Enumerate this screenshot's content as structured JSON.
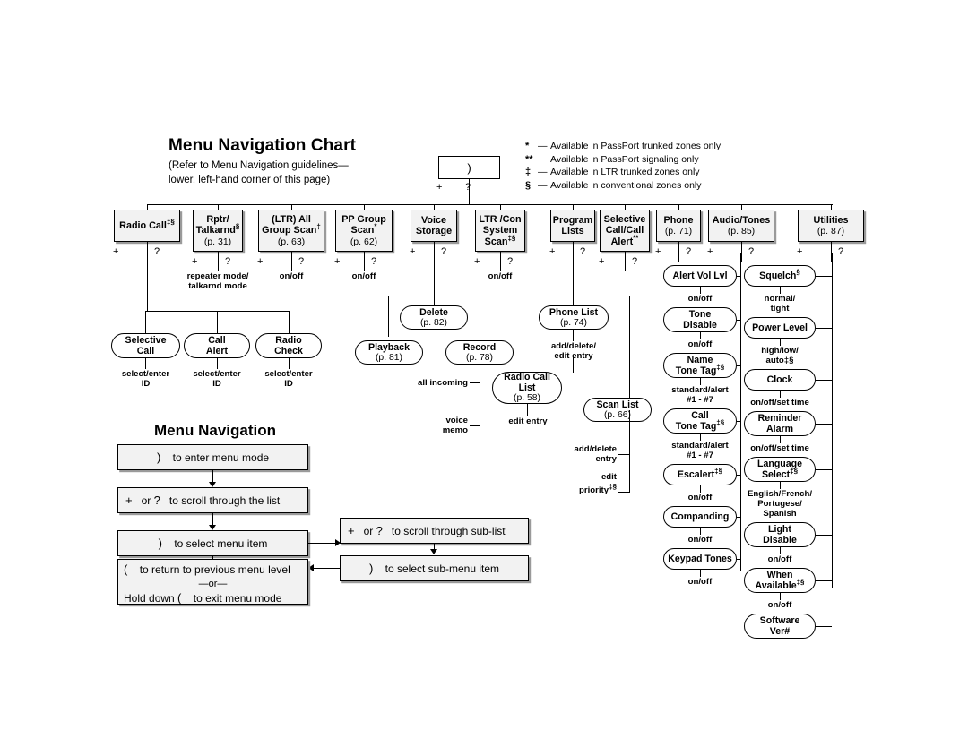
{
  "header": {
    "title": "Menu Navigation Chart",
    "subtitle_line1": "(Refer to Menu Navigation guidelines—",
    "subtitle_line2": "lower, left-hand corner of this page)",
    "enter_box_symbol": ")",
    "enter_box_plus": "+",
    "enter_box_minus": "?"
  },
  "legend": [
    {
      "symbol": "*",
      "dash": "—",
      "text": "Available in PassPort trunked zones only"
    },
    {
      "symbol": "**",
      "dash": "",
      "text": "Available in PassPort signaling only"
    },
    {
      "symbol": "‡",
      "dash": "—",
      "text": "Available in LTR trunked zones only"
    },
    {
      "symbol": "§",
      "dash": "—",
      "text": "Available in conventional zones only"
    }
  ],
  "top_menus": [
    {
      "name": "Radio Call",
      "sup": "‡§",
      "page": "",
      "plus": "+",
      "minus": "?",
      "note": ""
    },
    {
      "name": "Rptr/\nTalkarnd",
      "sup": "§",
      "page": "(p. 31)",
      "plus": "+",
      "minus": "?",
      "note": "repeater mode/\ntalkarnd mode"
    },
    {
      "name": "(LTR) All\nGroup Scan",
      "sup": "‡",
      "page": "(p. 63)",
      "plus": "+",
      "minus": "?",
      "note": "on/off"
    },
    {
      "name": "PP Group\nScan",
      "sup": "*",
      "page": "(p. 62)",
      "plus": "+",
      "minus": "?",
      "note": "on/off"
    },
    {
      "name": "Voice\nStorage",
      "sup": "",
      "page": "",
      "plus": "+",
      "minus": "?",
      "note": ""
    },
    {
      "name": "LTR /Con\nSystem\nScan",
      "sup": "‡§",
      "page": "",
      "plus": "+",
      "minus": "?",
      "note": "on/off"
    },
    {
      "name": "Program\nLists",
      "sup": "",
      "page": "",
      "plus": "+",
      "minus": "?",
      "note": ""
    },
    {
      "name": "Selective\nCall/Call\nAlert",
      "sup": "**",
      "page": "",
      "plus": "+",
      "minus": "?",
      "note": ""
    },
    {
      "name": "Phone",
      "sup": "",
      "page": "(p. 71)",
      "plus": "+",
      "minus": "?",
      "note": ""
    },
    {
      "name": "Audio/Tones",
      "sup": "",
      "page": "(p. 85)",
      "plus": "+",
      "minus": "?",
      "note": ""
    },
    {
      "name": "Utilities",
      "sup": "",
      "page": "(p. 87)",
      "plus": "+",
      "minus": "?",
      "note": ""
    }
  ],
  "radio_call_children": [
    {
      "name": "Selective\nCall",
      "note": "select/enter\nID"
    },
    {
      "name": "Call\nAlert",
      "note": "select/enter\nID"
    },
    {
      "name": "Radio\nCheck",
      "note": "select/enter\nID"
    }
  ],
  "voice_storage": {
    "delete": {
      "name": "Delete",
      "page": "(p. 82)"
    },
    "playback": {
      "name": "Playback",
      "page": "(p. 81)"
    },
    "record": {
      "name": "Record",
      "page": "(p. 78)"
    },
    "record_opt1": "all incoming",
    "record_opt2": "voice\nmemo"
  },
  "program_lists": {
    "phone_list": {
      "name": "Phone List",
      "page": "(p. 74)"
    },
    "phone_note": "add/delete/\nedit entry",
    "radio_call_list": {
      "name": "Radio Call\nList",
      "page": "(p. 58)"
    },
    "radio_note": "edit entry",
    "scan_list": {
      "name": "Scan List",
      "page": "(p. 66)"
    },
    "scan_note1": "add/delete\nentry",
    "scan_note2": "edit\npriority",
    "scan_note2_sup": "‡§"
  },
  "audio_tones": [
    {
      "name": "Alert Vol Lvl",
      "sup": "",
      "note": "on/off"
    },
    {
      "name": "Tone\nDisable",
      "sup": "",
      "note": "on/off"
    },
    {
      "name": "Name\nTone Tag",
      "sup": "‡§",
      "note": "standard/alert\n#1 - #7"
    },
    {
      "name": "Call\nTone Tag",
      "sup": "‡§",
      "sup_inline": true,
      "note": "standard/alert\n#1 - #7"
    },
    {
      "name": "Escalert",
      "sup": "‡§",
      "note": "on/off"
    },
    {
      "name": "Companding",
      "sup": "",
      "note": "on/off"
    },
    {
      "name": "Keypad Tones",
      "sup": "",
      "note": "on/off"
    }
  ],
  "utilities": [
    {
      "name": "Squelch",
      "sup": "§",
      "note": "normal/\ntight"
    },
    {
      "name": "Power Level",
      "sup": "",
      "note": "high/low/\nauto‡§"
    },
    {
      "name": "Clock",
      "sup": "",
      "note": "on/off/set time"
    },
    {
      "name": "Reminder\nAlarm",
      "sup": "",
      "note": "on/off/set time"
    },
    {
      "name": "Language\nSelect",
      "sup": "‡§",
      "note": "English/French/\nPortugese/\nSpanish"
    },
    {
      "name": "Light\nDisable",
      "sup": "",
      "note": "on/off"
    },
    {
      "name": "When\nAvailable",
      "sup": "‡§",
      "note": "on/off"
    },
    {
      "name": "Software\nVer#",
      "sup": "",
      "note": ""
    }
  ],
  "nav": {
    "title": "Menu Navigation",
    "step1": {
      "key": ")",
      "text": "to enter menu mode"
    },
    "step2": {
      "key": "+",
      "mid": "or",
      "key2": "?",
      "text": "to scroll through the list"
    },
    "step3": {
      "key": ")",
      "text": "to select menu item"
    },
    "step4": {
      "line1_key": "(",
      "line1_text": "to return to previous menu level",
      "line2": "—or—",
      "line3_prefix": "Hold down",
      "line3_key": "(",
      "line3_text": "to exit menu mode"
    },
    "step5": {
      "key": "+",
      "mid": "or",
      "key2": "?",
      "text": "to scroll through sub-list"
    },
    "step6": {
      "key": ")",
      "text": "to select sub-menu item"
    }
  }
}
